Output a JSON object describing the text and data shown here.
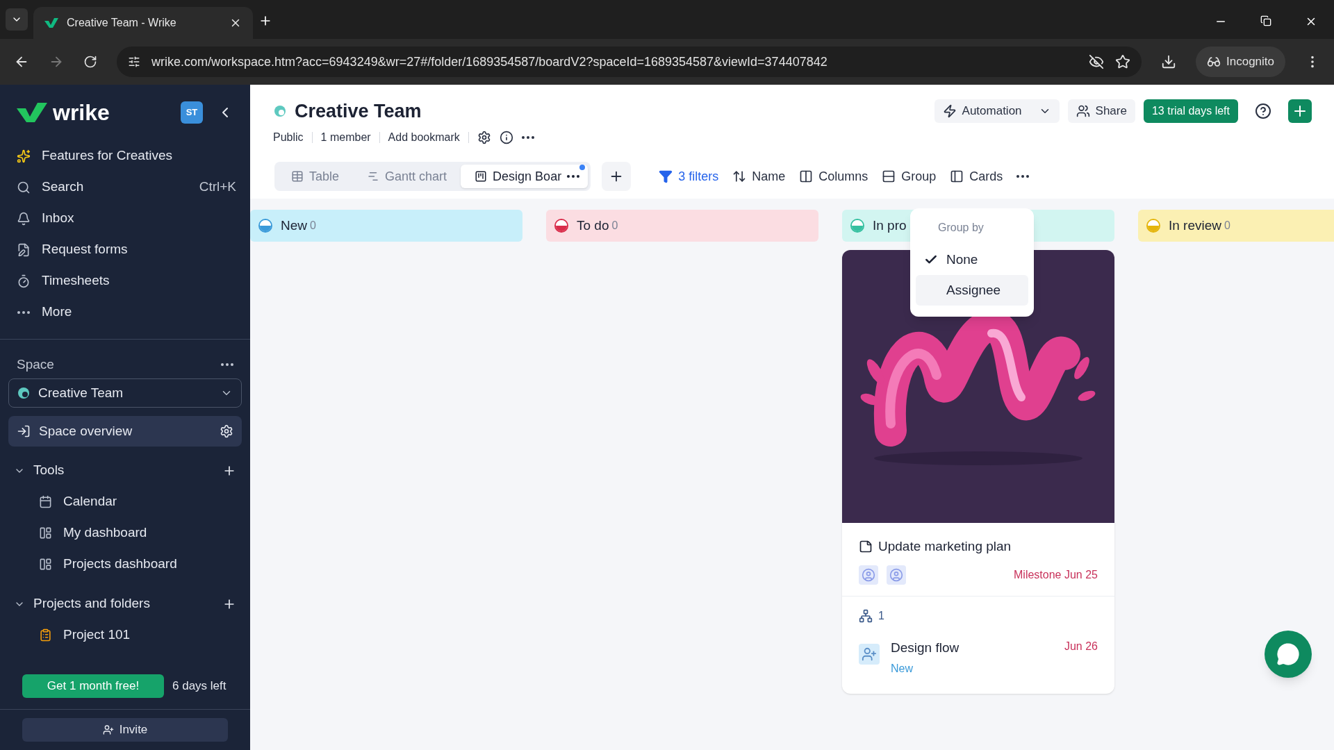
{
  "browser": {
    "tab_title": "Creative Team - Wrike",
    "url": "wrike.com/workspace.htm?acc=6943249&wr=27#/folder/1689354587/boardV2?spaceId=1689354587&viewId=374407842",
    "profile": "Incognito"
  },
  "sidebar": {
    "logo": "wrike",
    "avatar": "ST",
    "nav": [
      {
        "label": "Features for Creatives"
      },
      {
        "label": "Search",
        "shortcut": "Ctrl+K"
      },
      {
        "label": "Inbox"
      },
      {
        "label": "Request forms"
      },
      {
        "label": "Timesheets"
      },
      {
        "label": "More"
      }
    ],
    "space_label": "Space",
    "space_selector": "Creative Team",
    "space_overview": {
      "label": "Space overview",
      "selected": true
    },
    "sections": [
      {
        "title": "Tools",
        "expanded": true,
        "items": [
          {
            "label": "Calendar"
          },
          {
            "label": "My dashboard"
          },
          {
            "label": "Projects dashboard"
          }
        ]
      },
      {
        "title": "Projects and folders",
        "expanded": true,
        "items": [
          {
            "label": "Project 101"
          }
        ]
      }
    ],
    "promo_button": "Get 1 month free!",
    "days_left": "6 days left",
    "invite": "Invite"
  },
  "header": {
    "title": "Creative Team",
    "meta": [
      "Public",
      "1 member",
      "Add bookmark"
    ],
    "automation": "Automation",
    "share": "Share",
    "trial": "13 trial days left"
  },
  "views": [
    {
      "label": "Table",
      "selected": false,
      "notification": false
    },
    {
      "label": "Gantt chart",
      "selected": false,
      "notification": false
    },
    {
      "label": "Design Boar",
      "selected": true,
      "notification": true
    }
  ],
  "toolbar": [
    "3 filters",
    "Name",
    "Columns",
    "Group",
    "Cards"
  ],
  "group_menu": {
    "heading": "Group by",
    "options": [
      {
        "label": "None",
        "selected": true,
        "hovered": false
      },
      {
        "label": "Assignee",
        "selected": false,
        "hovered": true
      }
    ]
  },
  "columns": [
    {
      "title": "New",
      "count": "0",
      "color": "#3b9ad9"
    },
    {
      "title": "To do",
      "count": "0",
      "color": "#d92d4b"
    },
    {
      "title": "In pro",
      "color": "#35c0a0"
    },
    {
      "title": "In review",
      "count": "0",
      "color": "#e4b50c"
    }
  ],
  "card": {
    "kind": "picture",
    "title": "Update marketing plan",
    "milestone": "Milestone Jun 25",
    "subtask_count": "1",
    "subtask": {
      "title": "Design flow",
      "status": "New",
      "date": "Jun 26"
    }
  }
}
